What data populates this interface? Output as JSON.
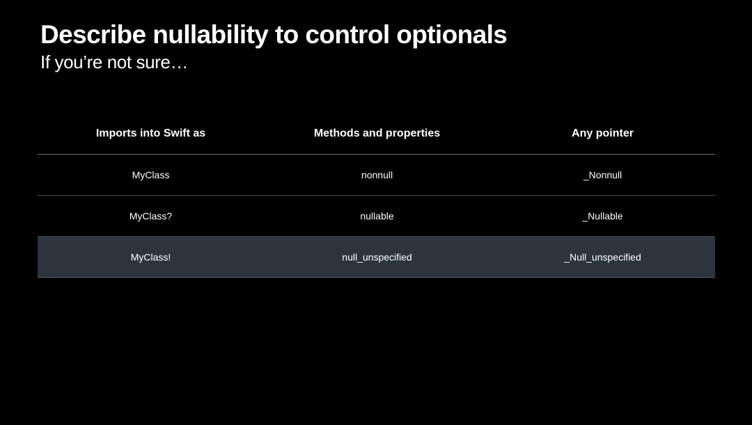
{
  "slide": {
    "title": "Describe nullability to control optionals",
    "subtitle": "If you’re not sure…",
    "highlight_color": "#2c343d"
  },
  "table": {
    "headers": [
      "Imports into Swift as",
      "Methods and properties",
      "Any pointer"
    ],
    "rows": [
      {
        "cells": [
          "MyClass",
          "nonnull",
          "_Nonnull"
        ],
        "highlighted": false
      },
      {
        "cells": [
          "MyClass?",
          "nullable",
          "_Nullable"
        ],
        "highlighted": false
      },
      {
        "cells": [
          "MyClass!",
          "null_unspecified",
          "_Null_unspecified"
        ],
        "highlighted": true
      }
    ]
  }
}
